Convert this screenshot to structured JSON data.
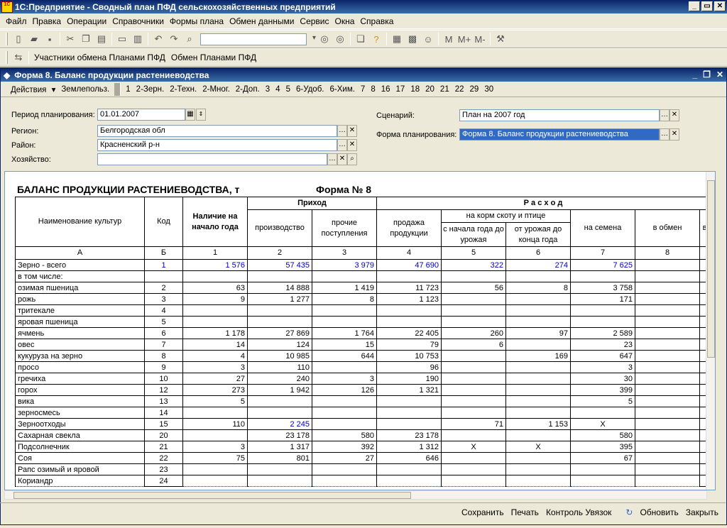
{
  "app": {
    "title": "1С:Предприятие - Сводный план ПФД сельскохозяйственных предприятий"
  },
  "menu": [
    "Файл",
    "Правка",
    "Операции",
    "Справочники",
    "Формы плана",
    "Обмен данными",
    "Сервис",
    "Окна",
    "Справка"
  ],
  "toolbar2": {
    "participants": "Участники обмена Планами ПФД",
    "exchange": "Обмен Планами ПФД"
  },
  "toolbar_marks": {
    "m": "M",
    "mplus": "M+",
    "mminus": "M-"
  },
  "doc": {
    "title": "Форма 8. Баланс продукции растениеводства"
  },
  "formbar": {
    "actions": "Действия",
    "items": [
      "Землепольз.",
      "1",
      "2-Зерн.",
      "2-Техн.",
      "2-Мног.",
      "2-Доп.",
      "3",
      "4",
      "5",
      "6-Удоб.",
      "6-Хим.",
      "7",
      "8",
      "16",
      "17",
      "18",
      "20",
      "21",
      "22",
      "29",
      "30"
    ]
  },
  "fields": {
    "period_label": "Период планирования:",
    "period_value": "01.01.2007",
    "region_label": "Регион:",
    "region_value": "Белгородская обл",
    "district_label": "Район:",
    "district_value": "Красненский р-н",
    "farm_label": "Хозяйство:",
    "farm_value": "",
    "scenario_label": "Сценарий:",
    "scenario_value": "План на 2007 год",
    "form_label": "Форма планирования:",
    "form_value": "Форма 8. Баланс продукции растениеводства"
  },
  "sheet": {
    "title": "БАЛАНС ПРОДУКЦИИ РАСТЕНИЕВОДСТВА, т",
    "form_no": "Форма № 8",
    "h_crop": "Наименование культур",
    "h_code": "Код",
    "h_stock": "Наличие на начало года",
    "h_income": "Приход",
    "h_production": "производство",
    "h_other": "прочие поступления",
    "h_expense": "Р а с х о д",
    "h_sales": "продажа продукции",
    "h_feed": "на корм скоту и птице",
    "h_feed_start": "с начала года до урожая",
    "h_feed_harvest": "от урожая до конца года",
    "h_seeds": "на семена",
    "h_exchange": "в обмен",
    "h_more": "в",
    "col_ids": [
      "А",
      "Б",
      "1",
      "2",
      "3",
      "4",
      "5",
      "6",
      "7",
      "8"
    ]
  },
  "rows": [
    {
      "name": "Зерно - всего",
      "code": "1",
      "c1": "1 576",
      "c2": "57 435",
      "c3": "3 979",
      "c4": "47 690",
      "c5": "322",
      "c6": "274",
      "c7": "7 625",
      "c8": "",
      "blue": true
    },
    {
      "name": "    в том числе:",
      "code": "",
      "c1": "",
      "c2": "",
      "c3": "",
      "c4": "",
      "c5": "",
      "c6": "",
      "c7": "",
      "c8": ""
    },
    {
      "name": " озимая пшеница",
      "code": "2",
      "c1": "63",
      "c2": "14 888",
      "c3": "1 419",
      "c4": "11 723",
      "c5": "56",
      "c6": "8",
      "c7": "3 758",
      "c8": ""
    },
    {
      "name": " рожь",
      "code": "3",
      "c1": "9",
      "c2": "1 277",
      "c3": "8",
      "c4": "1 123",
      "c5": "",
      "c6": "",
      "c7": "171",
      "c8": ""
    },
    {
      "name": " тритекале",
      "code": "4",
      "c1": "",
      "c2": "",
      "c3": "",
      "c4": "",
      "c5": "",
      "c6": "",
      "c7": "",
      "c8": ""
    },
    {
      "name": " яровая пшеница",
      "code": "5",
      "c1": "",
      "c2": "",
      "c3": "",
      "c4": "",
      "c5": "",
      "c6": "",
      "c7": "",
      "c8": ""
    },
    {
      "name": " ячмень",
      "code": "6",
      "c1": "1 178",
      "c2": "27 869",
      "c3": "1 764",
      "c4": "22 405",
      "c5": "260",
      "c6": "97",
      "c7": "2 589",
      "c8": ""
    },
    {
      "name": " овес",
      "code": "7",
      "c1": "14",
      "c2": "124",
      "c3": "15",
      "c4": "79",
      "c5": "6",
      "c6": "",
      "c7": "23",
      "c8": ""
    },
    {
      "name": " кукуруза на зерно",
      "code": "8",
      "c1": "4",
      "c2": "10 985",
      "c3": "644",
      "c4": "10 753",
      "c5": "",
      "c6": "169",
      "c7": "647",
      "c8": ""
    },
    {
      "name": " просо",
      "code": "9",
      "c1": "3",
      "c2": "110",
      "c3": "",
      "c4": "96",
      "c5": "",
      "c6": "",
      "c7": "3",
      "c8": ""
    },
    {
      "name": " гречиха",
      "code": "10",
      "c1": "27",
      "c2": "240",
      "c3": "3",
      "c4": "190",
      "c5": "",
      "c6": "",
      "c7": "30",
      "c8": ""
    },
    {
      "name": " горох",
      "code": "12",
      "c1": "273",
      "c2": "1 942",
      "c3": "126",
      "c4": "1 321",
      "c5": "",
      "c6": "",
      "c7": "399",
      "c8": ""
    },
    {
      "name": " вика",
      "code": "13",
      "c1": "5",
      "c2": "",
      "c3": "",
      "c4": "",
      "c5": "",
      "c6": "",
      "c7": "5",
      "c8": ""
    },
    {
      "name": " зерносмесь",
      "code": "14",
      "c1": "",
      "c2": "",
      "c3": "",
      "c4": "",
      "c5": "",
      "c6": "",
      "c7": "",
      "c8": ""
    },
    {
      "name": "Зерноотходы",
      "code": "15",
      "c1": "110",
      "c2": "2 245",
      "c3": "",
      "c4": "",
      "c5": "71",
      "c6": "1 153",
      "c7": "X",
      "c8": "",
      "blue2": true
    },
    {
      "name": "Сахарная свекла",
      "code": "20",
      "c1": "",
      "c2": "23 178",
      "c3": "580",
      "c4": "23 178",
      "c5": "",
      "c6": "",
      "c7": "580",
      "c8": ""
    },
    {
      "name": "Подсолнечник",
      "code": "21",
      "c1": "3",
      "c2": "1 317",
      "c3": "392",
      "c4": "1 312",
      "c5": "X",
      "c6": "X",
      "c7": "395",
      "c8": ""
    },
    {
      "name": "Соя",
      "code": "22",
      "c1": "75",
      "c2": "801",
      "c3": "27",
      "c4": "646",
      "c5": "",
      "c6": "",
      "c7": "67",
      "c8": ""
    },
    {
      "name": "Рапс озимый и яровой",
      "code": "23",
      "c1": "",
      "c2": "",
      "c3": "",
      "c4": "",
      "c5": "",
      "c6": "",
      "c7": "",
      "c8": ""
    },
    {
      "name": "Кориандр",
      "code": "24",
      "c1": "",
      "c2": "",
      "c3": "",
      "c4": "",
      "c5": "",
      "c6": "",
      "c7": "",
      "c8": ""
    }
  ],
  "status": {
    "save": "Сохранить",
    "print": "Печать",
    "control": "Контроль Увязок",
    "refresh": "Обновить",
    "close": "Закрыть"
  }
}
